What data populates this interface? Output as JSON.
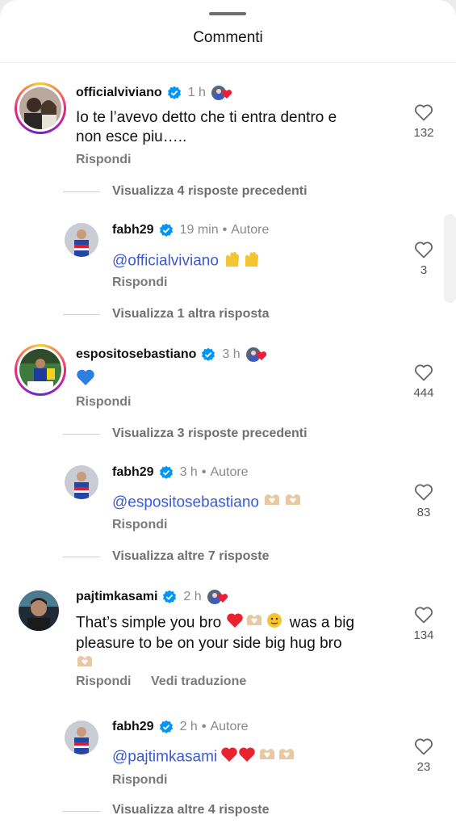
{
  "header": {
    "title": "Commenti"
  },
  "comments": [
    {
      "username": "officialviviano",
      "time": "1 h",
      "text_lines": [
        "Io te l’avevo detto che ti entra dentro e",
        "non esce piu….."
      ],
      "reply_label": "Rispondi",
      "likes": "132"
    },
    {
      "thread_label": "Visualizza 4 risposte precedenti"
    },
    {
      "username": "fabh29",
      "time": "19 min",
      "author_label": "Autore",
      "mention": "@officialviviano",
      "reply_label": "Rispondi",
      "likes": "3"
    },
    {
      "thread_label": "Visualizza 1 altra risposta"
    },
    {
      "username": "espositosebastiano",
      "time": "3 h",
      "reply_label": "Rispondi",
      "likes": "444"
    },
    {
      "thread_label": "Visualizza 3 risposte precedenti"
    },
    {
      "username": "fabh29",
      "time": "3 h",
      "author_label": "Autore",
      "mention": "@espositosebastiano",
      "reply_label": "Rispondi",
      "likes": "83"
    },
    {
      "thread_label": "Visualizza altre 7 risposte"
    },
    {
      "username": "pajtimkasami",
      "time": "2 h",
      "text_line1": "That’s simple you bro",
      "text_line1b": "was a big",
      "text_line2": "pleasure to be on your side big hug bro",
      "reply_label": "Rispondi",
      "translate_label": "Vedi traduzione",
      "likes": "134"
    },
    {
      "username": "fabh29",
      "time": "2 h",
      "author_label": "Autore",
      "mention": "@pajtimkasami",
      "reply_label": "Rispondi",
      "likes": "23"
    }
  ],
  "footer_partial": "Visualizza altre 4 risposte",
  "colors": {
    "mention": "#3b59d6",
    "verified": "#0095f6",
    "heart": "#ed1c3a"
  }
}
